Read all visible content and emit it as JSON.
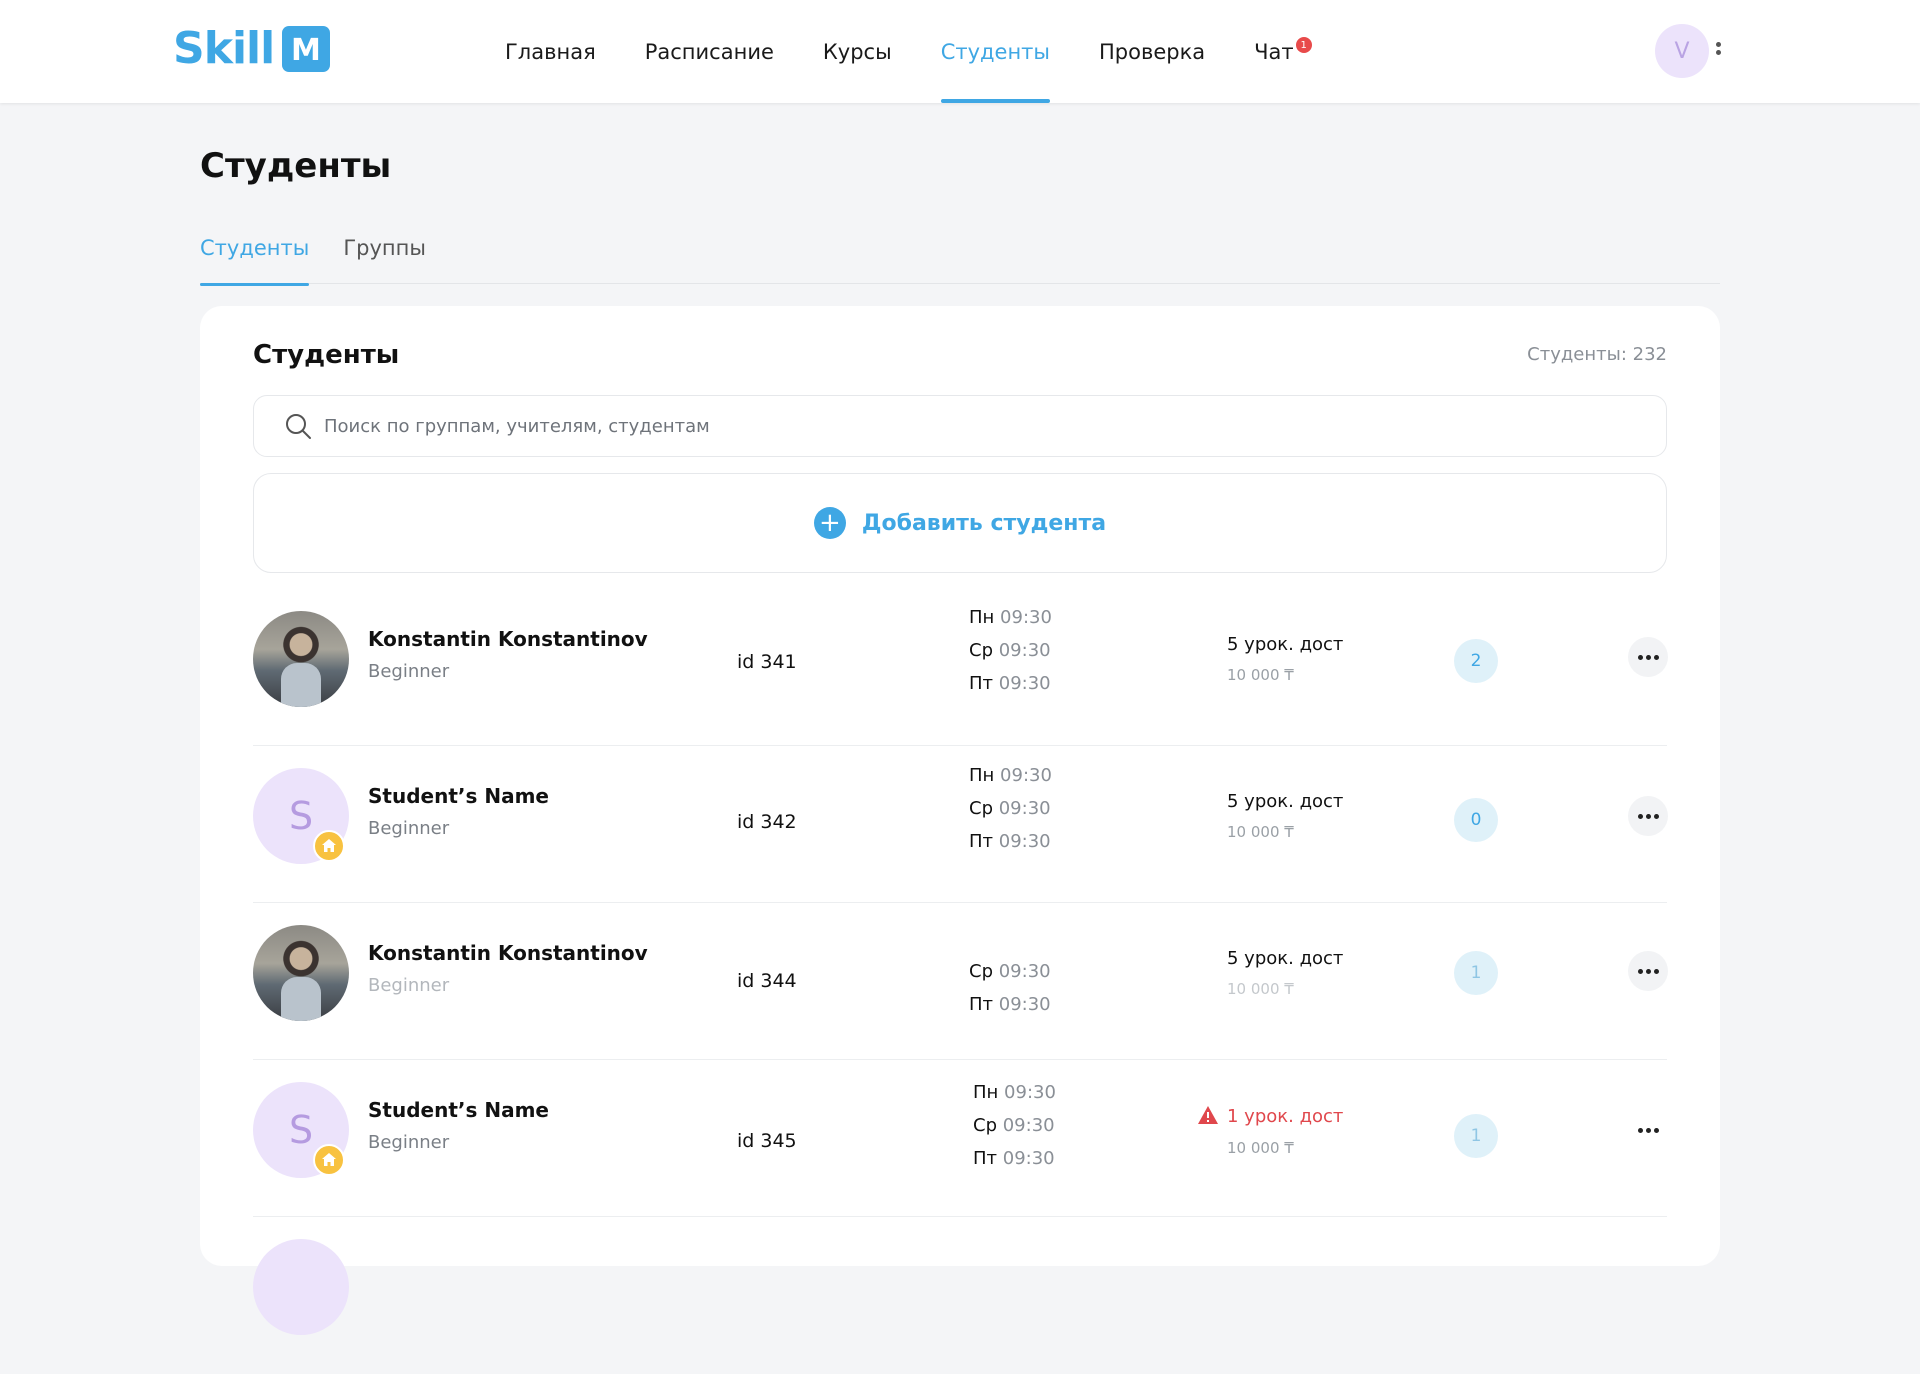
{
  "brand": {
    "logo_text": "Skill",
    "logo_letter": "M",
    "accent": "#3fa7e4"
  },
  "nav": {
    "items": [
      {
        "label": "Главная"
      },
      {
        "label": "Расписание"
      },
      {
        "label": "Курсы"
      },
      {
        "label": "Студенты",
        "active": true
      },
      {
        "label": "Проверка"
      },
      {
        "label": "Чат",
        "badge": "1"
      }
    ]
  },
  "user": {
    "initial": "V"
  },
  "page": {
    "title": "Студенты"
  },
  "tabs": [
    {
      "label": "Студенты",
      "active": true
    },
    {
      "label": "Группы"
    }
  ],
  "card": {
    "title": "Студенты",
    "count": "Студенты: 232",
    "search_placeholder": "Поиск по группам, учителям, студентам",
    "add_label": "Добавить студента"
  },
  "students": [
    {
      "avatar": "photo",
      "name": "Konstantin Konstantinov",
      "level": "Beginner",
      "id": "id 341",
      "schedule": [
        {
          "day": "Пн",
          "time": "09:30"
        },
        {
          "day": "Ср",
          "time": "09:30"
        },
        {
          "day": "Пт",
          "time": "09:30"
        }
      ],
      "lessons": "5 урок. дост",
      "price": "10 000 ₸",
      "count": "2"
    },
    {
      "avatar": "letter",
      "initial": "S",
      "home": true,
      "name": "Student’s Name",
      "level": "Beginner",
      "id": "id 342",
      "schedule": [
        {
          "day": "Пн",
          "time": "09:30"
        },
        {
          "day": "Ср",
          "time": "09:30"
        },
        {
          "day": "Пт",
          "time": "09:30"
        }
      ],
      "lessons": "5 урок. дост",
      "price": "10 000 ₸",
      "count": "0"
    },
    {
      "avatar": "photo",
      "name": "Konstantin Konstantinov",
      "level": "Beginner",
      "id": "id 344",
      "schedule": [
        {
          "day": "Ср",
          "time": "09:30"
        },
        {
          "day": "Пт",
          "time": "09:30"
        }
      ],
      "lessons": "5 урок. дост",
      "price": "10 000 ₸",
      "count": "1"
    },
    {
      "avatar": "letter",
      "initial": "S",
      "home": true,
      "name": "Student’s Name",
      "level": "Beginner",
      "id": "id 345",
      "schedule": [
        {
          "day": "Пн",
          "time": "09:30"
        },
        {
          "day": "Ср",
          "time": "09:30"
        },
        {
          "day": "Пт",
          "time": "09:30"
        }
      ],
      "lessons": "1 урок. дост",
      "warning": true,
      "price": "10 000 ₸",
      "count": "1"
    }
  ]
}
